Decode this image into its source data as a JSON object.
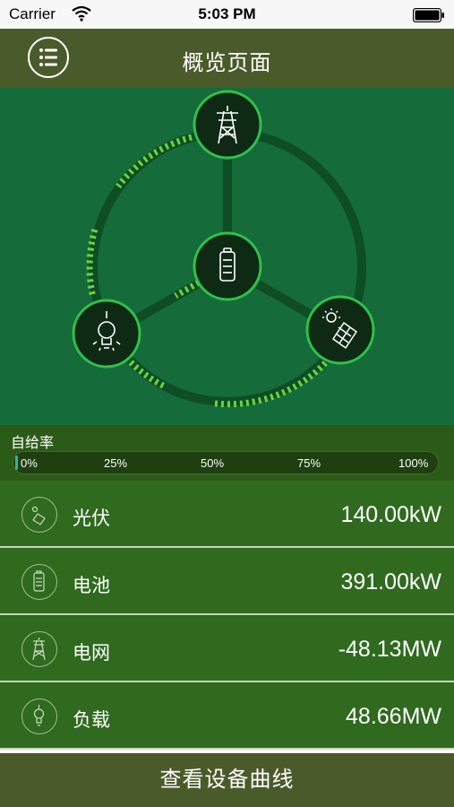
{
  "status_bar": {
    "carrier": "Carrier",
    "time": "5:03 PM"
  },
  "header": {
    "title": "概览页面",
    "menu_icon": "list-menu-icon"
  },
  "diagram": {
    "nodes": {
      "grid_icon": "transmission-tower-icon",
      "battery_icon": "battery-icon",
      "load_icon": "light-bulb-icon",
      "solar_icon": "solar-panel-icon"
    }
  },
  "self_sufficiency": {
    "label": "自给率",
    "value_fraction": 0.0,
    "ticks": [
      "0%",
      "25%",
      "50%",
      "75%",
      "100%"
    ]
  },
  "rows": [
    {
      "label": "光伏",
      "value": "140.00kW",
      "icon": "solar-panel-icon"
    },
    {
      "label": "电池",
      "value": "391.00kW",
      "icon": "battery-icon"
    },
    {
      "label": "电网",
      "value": "-48.13MW",
      "icon": "transmission-tower-icon"
    },
    {
      "label": "负载",
      "value": "48.66MW",
      "icon": "light-bulb-icon"
    }
  ],
  "footer": {
    "button_label": "查看设备曲线"
  },
  "colors": {
    "nav_bg": "#4b5a2a",
    "diagram_bg": "#156b3a",
    "row_bg": "#2f6a1f",
    "flow_arrow": "#6bd33a",
    "node_fill": "#0f2a14",
    "node_ring": "#2fc14a"
  }
}
